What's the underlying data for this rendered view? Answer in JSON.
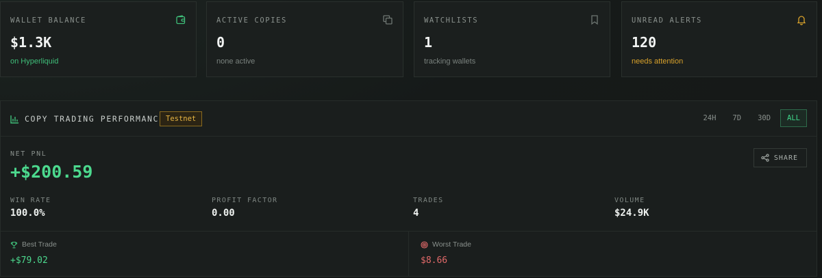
{
  "stats": [
    {
      "label": "WALLET BALANCE",
      "value": "$1.3K",
      "sub": "on Hyperliquid",
      "icon": "wallet-icon",
      "sub_color": "#3fbf7a"
    },
    {
      "label": "ACTIVE COPIES",
      "value": "0",
      "sub": "none active",
      "icon": "copy-icon"
    },
    {
      "label": "WATCHLISTS",
      "value": "1",
      "sub": "tracking wallets",
      "icon": "bookmark-icon"
    },
    {
      "label": "UNREAD ALERTS",
      "value": "120",
      "sub": "needs attention",
      "icon": "bell-icon",
      "sub_color": "#d9a22b"
    }
  ],
  "performance": {
    "title": "COPY TRADING PERFORMANCE",
    "title_icon": "bar-chart-icon",
    "env_badge": "Testnet",
    "ranges": [
      "24H",
      "7D",
      "30D",
      "ALL"
    ],
    "active_range": "ALL",
    "net_pnl_label": "NET PNL",
    "net_pnl_value": "+$200.59",
    "share_label": "SHARE",
    "share_icon": "share-icon",
    "metrics": [
      {
        "label": "WIN RATE",
        "value": "100.0%"
      },
      {
        "label": "PROFIT FACTOR",
        "value": "0.00"
      },
      {
        "label": "TRADES",
        "value": "4"
      },
      {
        "label": "VOLUME",
        "value": "$24.9K"
      }
    ],
    "best_trade": {
      "label": "Best Trade",
      "value": "+$79.02",
      "icon": "trophy-icon"
    },
    "worst_trade": {
      "label": "Worst Trade",
      "value": "$8.66",
      "icon": "target-icon"
    }
  },
  "colors": {
    "accent_green": "#4cd98e",
    "accent_amber": "#e7b543",
    "loss_red": "#e36a6a"
  }
}
